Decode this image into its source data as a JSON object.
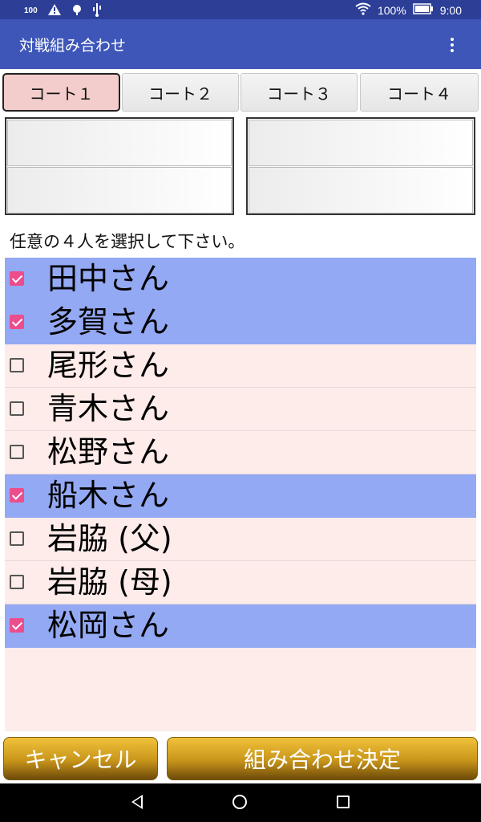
{
  "status_bar": {
    "notification_count": "100",
    "battery": "100%",
    "time": "9:00",
    "icons": [
      "alert-icon",
      "android-debug-icon",
      "usb-icon",
      "wifi-icon",
      "battery-icon"
    ]
  },
  "app_bar": {
    "title": "対戦組み合わせ",
    "menu_icon": "more-vert-icon"
  },
  "tabs": [
    {
      "label": "コート１",
      "active": true
    },
    {
      "label": "コート２",
      "active": false
    },
    {
      "label": "コート３",
      "active": false
    },
    {
      "label": "コート４",
      "active": false
    }
  ],
  "instruction": "任意の４人を選択して下さい。",
  "players": [
    {
      "name": "田中さん",
      "checked": true
    },
    {
      "name": "多賀さん",
      "checked": true
    },
    {
      "name": "尾形さん",
      "checked": false
    },
    {
      "name": "青木さん",
      "checked": false
    },
    {
      "name": "松野さん",
      "checked": false
    },
    {
      "name": "船木さん",
      "checked": true
    },
    {
      "name": "岩脇 (父)",
      "checked": false
    },
    {
      "name": "岩脇 (母)",
      "checked": false
    },
    {
      "name": "松岡さん",
      "checked": true
    }
  ],
  "buttons": {
    "cancel": "キャンセル",
    "confirm": "組み合わせ決定"
  },
  "colors": {
    "app_bar": "#3d56b8",
    "status_bar": "#2c3e96",
    "selected_row": "#94a9f3",
    "unselected_row": "#fdecea",
    "checkbox_on": "#ec4d8c",
    "active_tab": "#f3cccc"
  }
}
